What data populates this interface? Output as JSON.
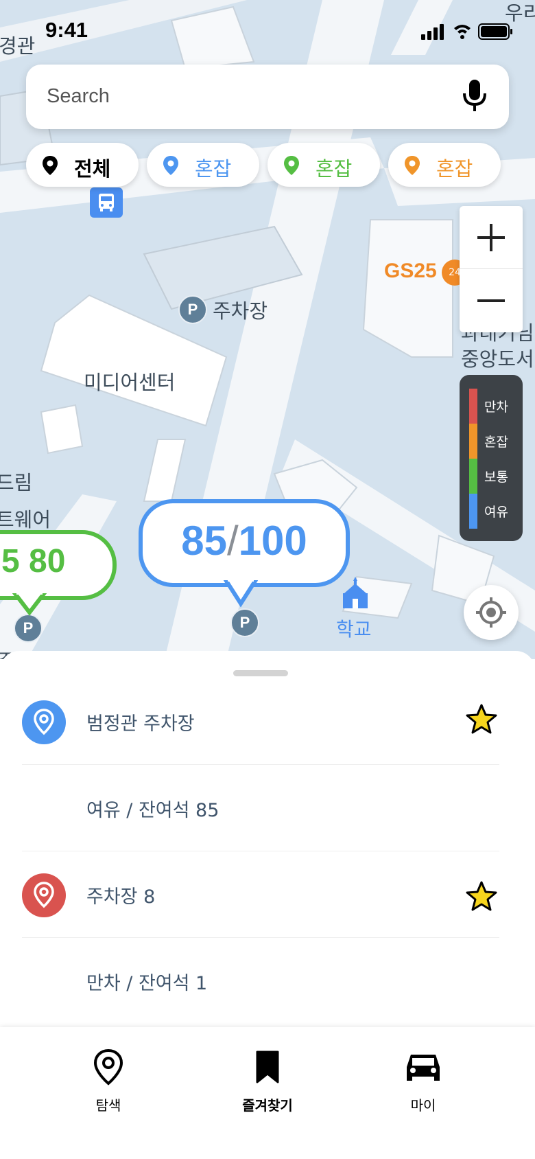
{
  "status_bar": {
    "time": "9:41"
  },
  "search": {
    "placeholder": "Search"
  },
  "filters": [
    {
      "label": "전체",
      "color": "#000000"
    },
    {
      "label": "혼잡",
      "color": "#4d96f0"
    },
    {
      "label": "혼잡",
      "color": "#55be43"
    },
    {
      "label": "혼잡",
      "color": "#f0952a"
    }
  ],
  "map": {
    "labels": {
      "top_left": "경관",
      "top_right": "우리",
      "parking": "주차장",
      "media_center": "미디어센터",
      "dream": "드림",
      "software": "트웨어",
      "gs25": "GS25",
      "gs25_badge": "24",
      "library_line1": "과대기님",
      "library_line2": "중앙도서",
      "school": "학교",
      "parking_bottom": "주차장"
    },
    "p_symbol": "P",
    "bubble_blue": {
      "used": "85",
      "separator": "/",
      "total": "100"
    },
    "bubble_green": {
      "text": "5 80"
    }
  },
  "zoom": {
    "in": "+",
    "out": "−"
  },
  "legend": [
    {
      "label": "만차",
      "color": "#d9534f"
    },
    {
      "label": "혼잡",
      "color": "#f0952a"
    },
    {
      "label": "보통",
      "color": "#55be43"
    },
    {
      "label": "여유",
      "color": "#4d96f0"
    }
  ],
  "list": [
    {
      "text": "범정관 주차장",
      "pin_color": "#4d96f0",
      "starred": true
    },
    {
      "text": "여유 / 잔여석 85"
    },
    {
      "text": "주차장 8",
      "pin_color": "#d9534f",
      "starred": true
    },
    {
      "text": "만차 / 잔여석 1"
    }
  ],
  "tabs": [
    {
      "label": "탐색",
      "icon": "map-pin-icon",
      "active": false
    },
    {
      "label": "즐겨찾기",
      "icon": "bookmark-icon",
      "active": true
    },
    {
      "label": "마이",
      "icon": "car-icon",
      "active": false
    }
  ]
}
